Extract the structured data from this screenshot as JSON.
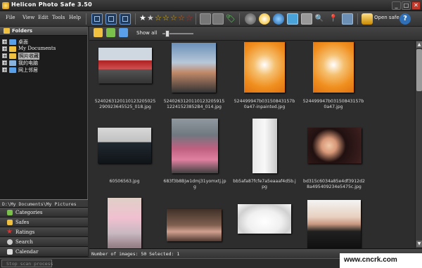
{
  "window": {
    "title": "Helicon Photo Safe 3.50",
    "min": "_",
    "max": "□",
    "close": "✕"
  },
  "menu": [
    "File",
    "View",
    "Edit",
    "Tools",
    "Help"
  ],
  "toolbar": {
    "open_safe": "Open safe",
    "help": "?",
    "tag": "🏷",
    "location": "📍",
    "search": "🔍"
  },
  "folders": {
    "title": "Folders",
    "items": [
      {
        "label": "桌面",
        "selected": false
      },
      {
        "label": "My Documents",
        "selected": false
      },
      {
        "label": "照片收藏",
        "selected": true
      },
      {
        "label": "我的电脑",
        "selected": false
      },
      {
        "label": "网上邻居",
        "selected": false
      }
    ]
  },
  "path": "D:\\My Documents\\My Pictures",
  "nav": [
    "Categories",
    "Safes",
    "Ratings",
    "Search",
    "Calendar"
  ],
  "content_toolbar": {
    "show_all": "Show all"
  },
  "thumbnails": [
    {
      "caption": "5240263120110123205025290923645525_018.jpg"
    },
    {
      "caption": "524026312011012320591512241523852B4_014.jpg"
    },
    {
      "caption": "524499947b03150843157b0a47-inpainted.jpg"
    },
    {
      "caption": "524499947b03150843157b0a47.jpg"
    },
    {
      "caption": "60506563.jpg"
    },
    {
      "caption": "683f3b8Bjw1dmj31yomxtj.jpg"
    },
    {
      "caption": "bb5afa87fcfe7a5eaaaf4d5b.jpg"
    },
    {
      "caption": "bd315c6034a85e4df3912d28a495409234e5475c.jpg"
    },
    {
      "caption": ""
    },
    {
      "caption": ""
    },
    {
      "caption": ""
    },
    {
      "caption": ""
    }
  ],
  "status": {
    "text": "Number of images: 50 Selected: 1"
  },
  "bottom": {
    "stop": "Stop scan process"
  },
  "watermark": "www.cncrk.com",
  "colors": {
    "accent": "#6d9bd6",
    "selected": "#b8b8b8",
    "star": "#f2c200"
  }
}
